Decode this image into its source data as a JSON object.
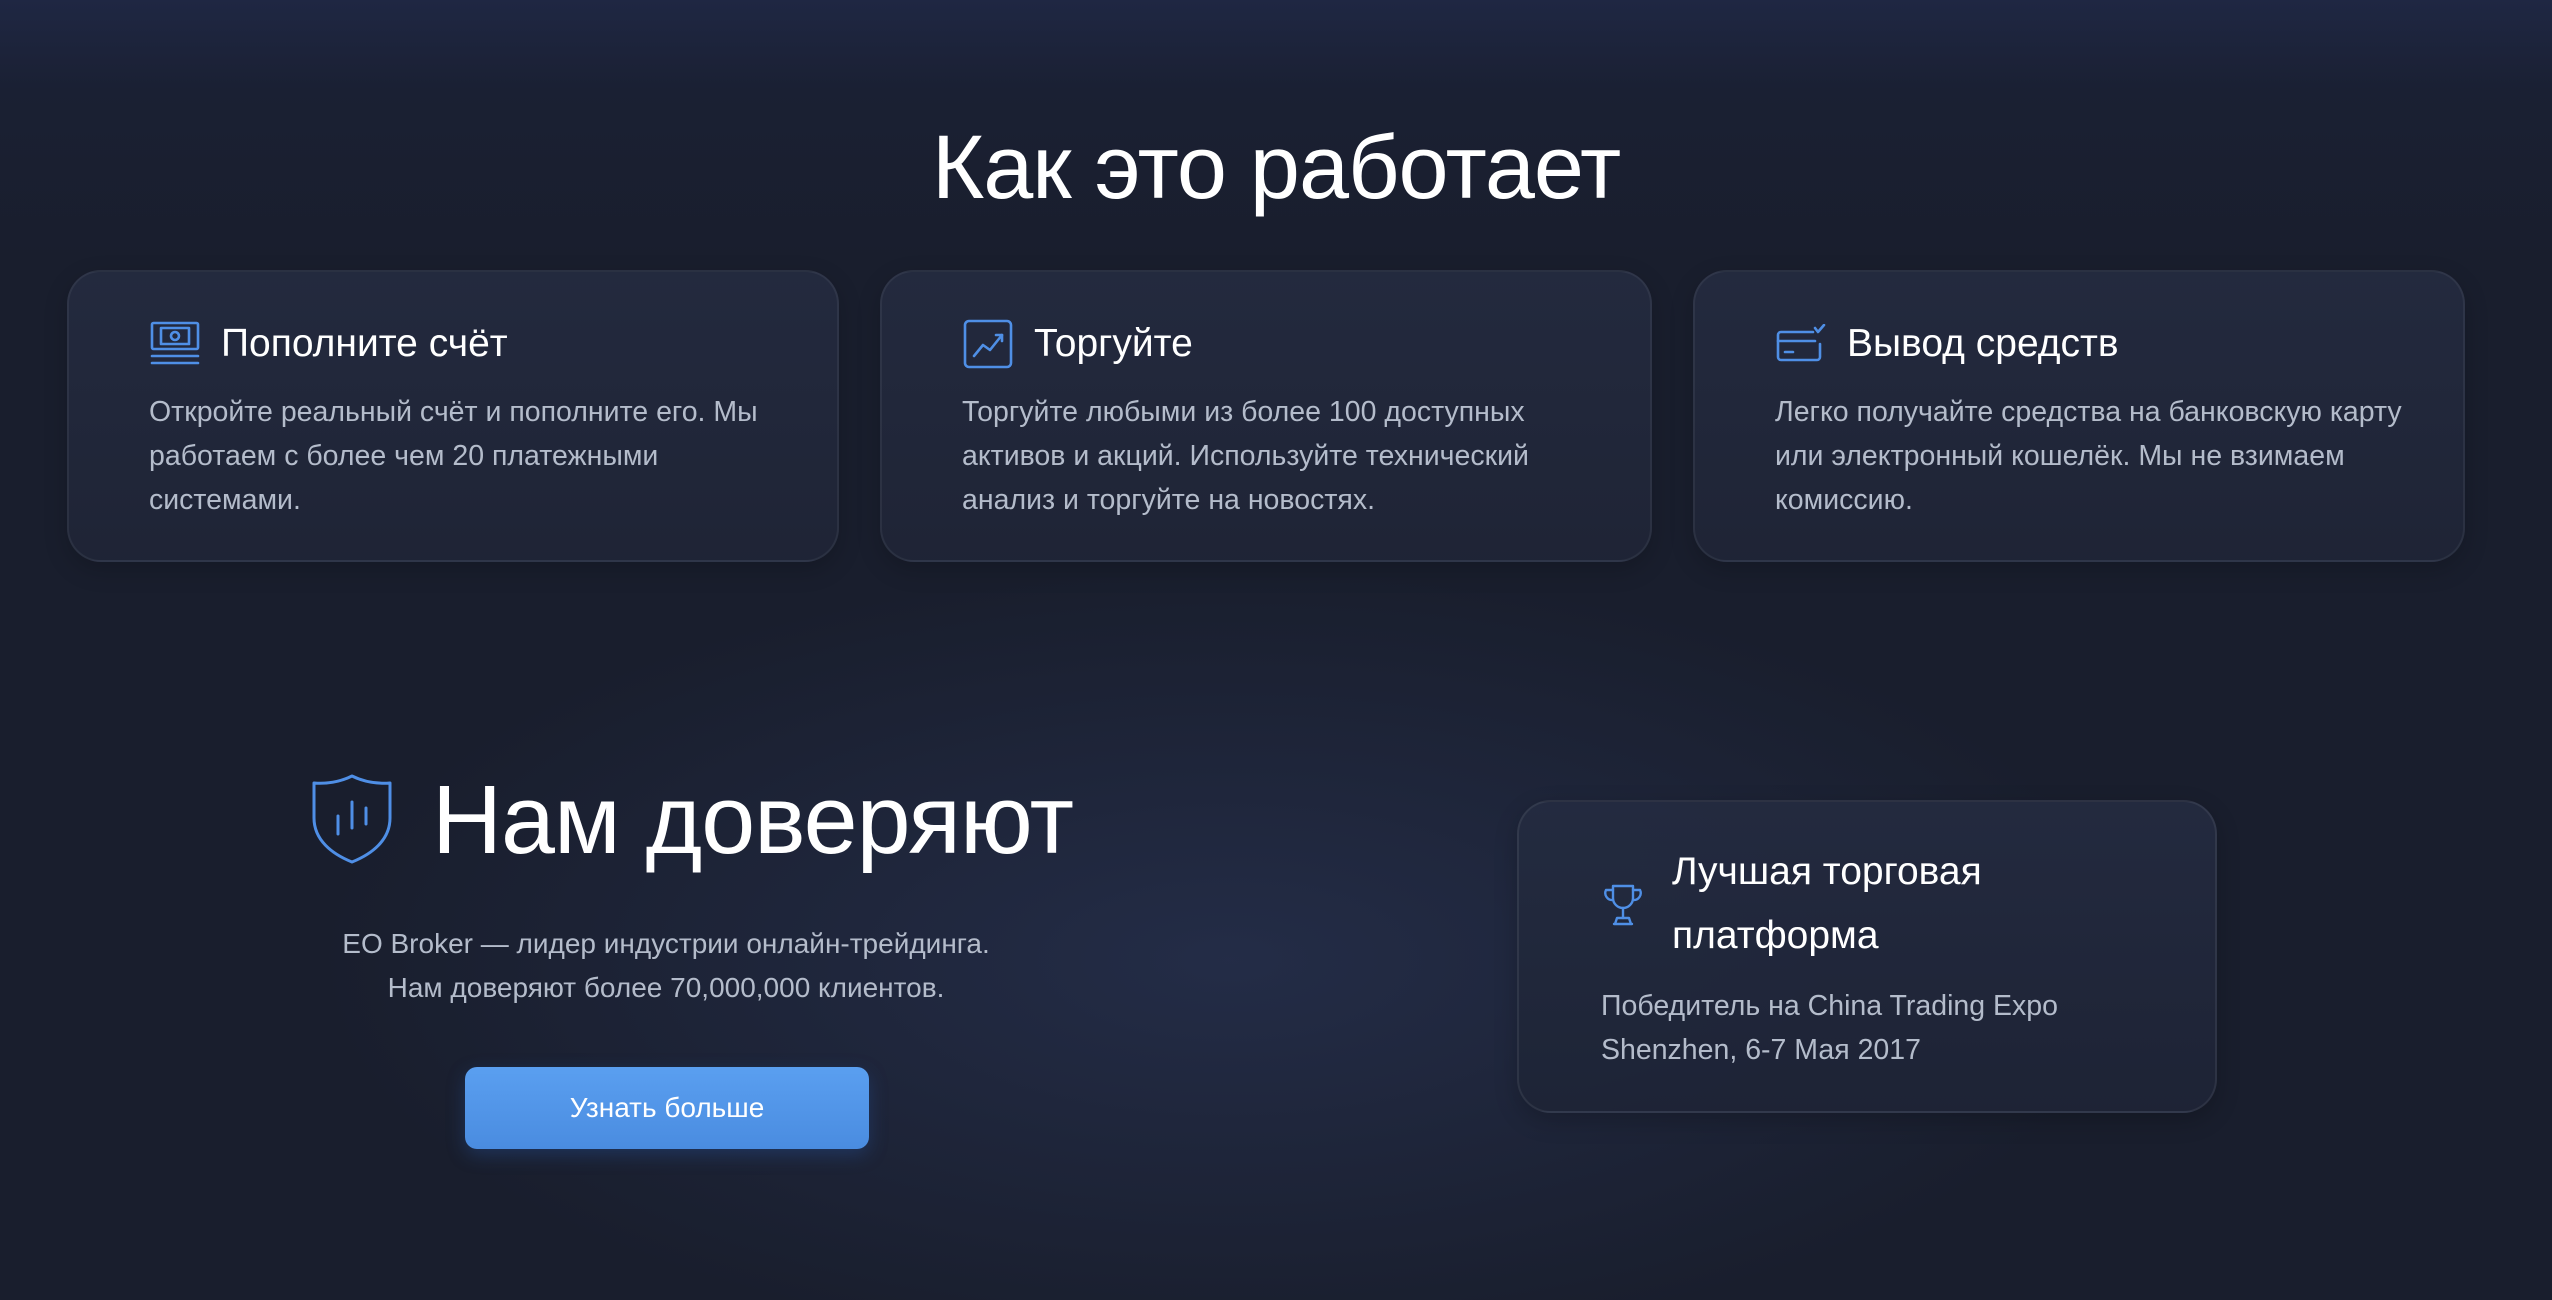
{
  "how_it_works": {
    "title": "Как это работает",
    "steps": [
      {
        "icon": "banknote-icon",
        "title": "Пополните счёт",
        "text": "Откройте реальный счёт и пополните его. Мы работаем с более чем 20 платежными системами."
      },
      {
        "icon": "trend-chart-icon",
        "title": "Торгуйте",
        "text": "Торгуйте любыми из более 100 доступных активов и акций. Используйте технический анализ и торгуйте на новостях."
      },
      {
        "icon": "card-withdraw-icon",
        "title": "Вывод средств",
        "text": "Легко получайте средства на банковскую карту или электронный кошелёк. Мы не взимаем комиссию."
      }
    ]
  },
  "trust": {
    "icon": "shield-chart-icon",
    "title": "Нам доверяют",
    "description_line1": "EO Broker — лидер индустрии онлайн-трейдинга.",
    "description_line2": "Нам доверяют более 70,000,000 клиентов.",
    "button_label": "Узнать больше"
  },
  "award": {
    "icon": "trophy-icon",
    "title": "Лучшая торговая платформа",
    "text_line1": "Победитель на China Trading Expo",
    "text_line2": "Shenzhen, 6-7 Мая 2017"
  },
  "colors": {
    "accent": "#4a8ce0",
    "icon_stroke": "#4f8fe6",
    "background": "#191e2d",
    "card_background": "#222840",
    "muted_text": "#b4bccb"
  }
}
